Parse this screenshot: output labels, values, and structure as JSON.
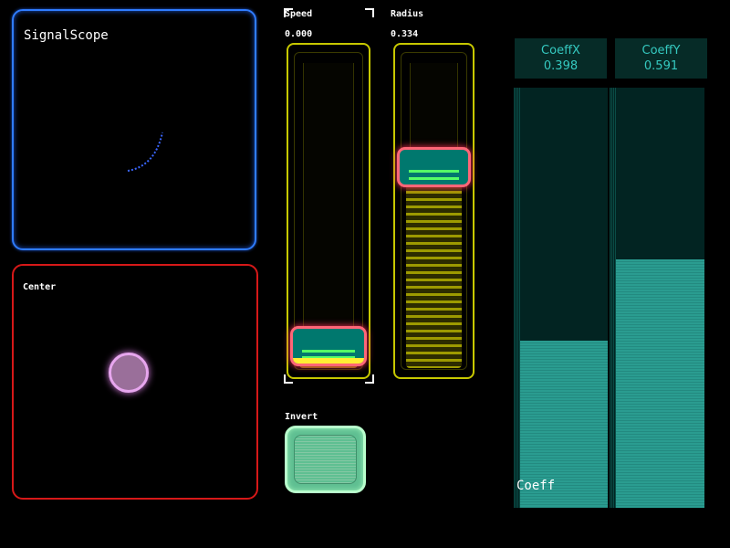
{
  "scope": {
    "title": "SignalScope"
  },
  "pad": {
    "title": "Center"
  },
  "sliders": [
    {
      "label": "Speed",
      "value": "0.000",
      "level": 0.0
    },
    {
      "label": "Radius",
      "value": "0.334",
      "level": 0.66
    }
  ],
  "invert": {
    "label": "Invert"
  },
  "coeffs": [
    {
      "label": "CoeffX",
      "value": "0.398",
      "level": 0.398
    },
    {
      "label": "CoeffY",
      "value": "0.591",
      "level": 0.591
    }
  ],
  "coeff_group_label": "Coeff",
  "colors": {
    "scope_border": "#2f7cff",
    "pad_border": "#d61818",
    "slider_border": "#c7c800",
    "knob_border": "#ff6677",
    "coeff_text": "#35c9c0",
    "coeff_fill": "#2a9c90",
    "invert_fill": "#5fbf92"
  }
}
